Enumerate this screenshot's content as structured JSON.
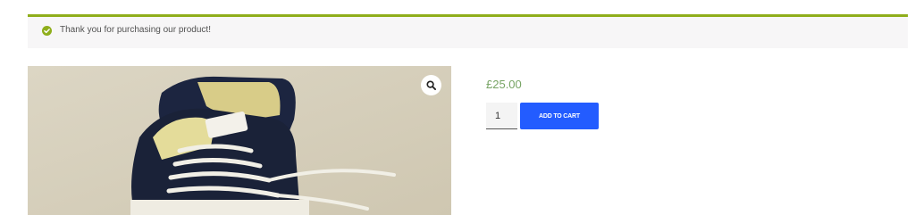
{
  "notice": {
    "message": "Thank you for purchasing our product!",
    "icon": "check-circle-icon",
    "accent_color": "#8fae1b"
  },
  "product": {
    "image_alt": "Navy canvas sneakers",
    "zoom_icon": "magnifier-icon",
    "price": "£25.00",
    "price_color": "#77a464",
    "quantity": "1",
    "add_to_cart_label": "ADD TO CART",
    "button_color": "#235cff"
  }
}
